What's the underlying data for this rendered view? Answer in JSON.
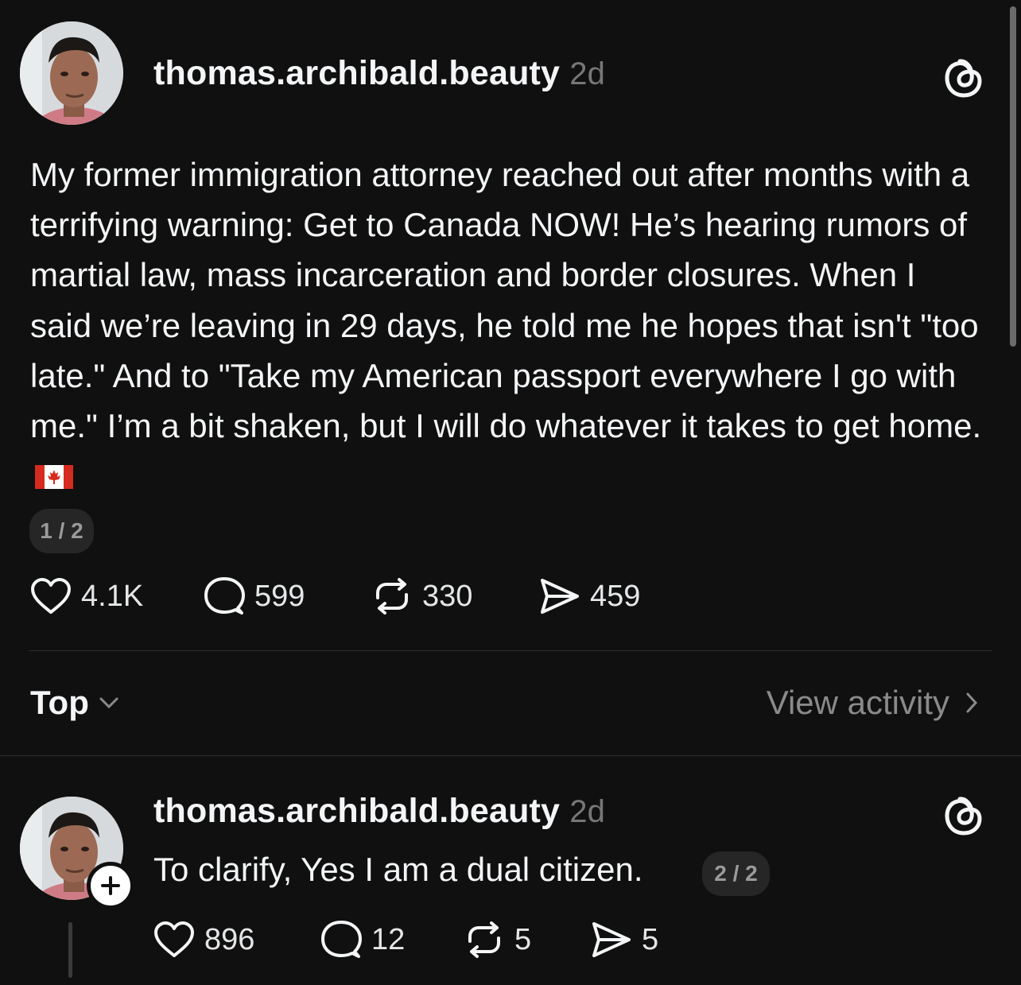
{
  "post": {
    "username": "thomas.archibald.beauty",
    "time": "2d",
    "text": "My former immigration attorney reached out after months with a terrifying warning: Get to Canada NOW! He’s hearing rumors of martial law, mass incarceration and border closures. When I said we’re leaving in 29 days, he told me he hopes that isn't \"too late.\" And to \"Take my American passport everywhere I go with me.\" I’m a bit shaken, but I will do whatever it takes to get home.",
    "flag_icon": "canada-flag-emoji",
    "page_indicator": "1 / 2",
    "likes": "4.1K",
    "replies": "599",
    "reposts": "330",
    "shares": "459"
  },
  "sort": {
    "label": "Top",
    "view_activity": "View activity"
  },
  "reply": {
    "username": "thomas.archibald.beauty",
    "time": "2d",
    "text": "To clarify, Yes I am a dual citizen.",
    "page_indicator": "2 / 2",
    "likes": "896",
    "replies": "12",
    "reposts": "5",
    "shares": "5"
  },
  "icons": {
    "like": "heart-icon",
    "reply": "comment-bubble-icon",
    "repost": "repost-icon",
    "share": "send-icon",
    "brand": "threads-logo-icon",
    "follow": "plus-icon"
  },
  "colors": {
    "background": "#101010",
    "text_primary": "#f3f5f7",
    "text_secondary": "#777777",
    "pill_background": "#262626"
  }
}
